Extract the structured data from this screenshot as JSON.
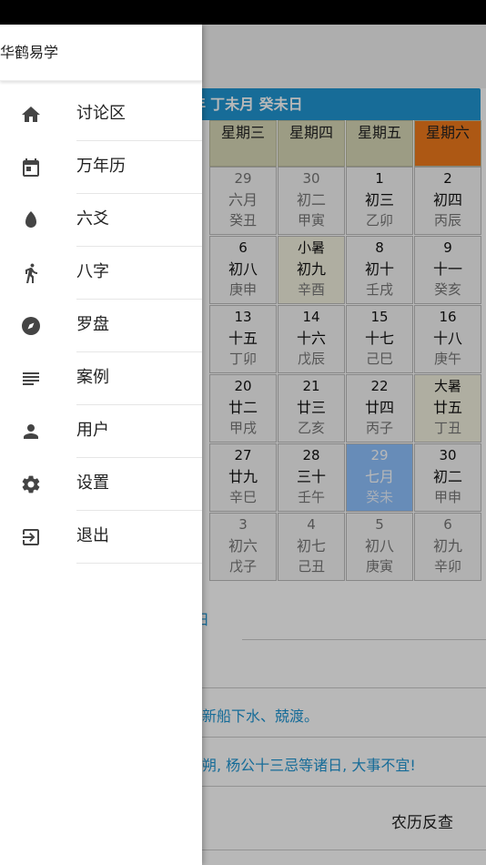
{
  "drawer": {
    "title": "华鹤易学",
    "items": [
      {
        "label": "讨论区",
        "icon": "home-icon"
      },
      {
        "label": "万年历",
        "icon": "calendar-icon"
      },
      {
        "label": "六爻",
        "icon": "leaf-icon"
      },
      {
        "label": "八字",
        "icon": "walk-icon"
      },
      {
        "label": "罗盘",
        "icon": "compass-icon"
      },
      {
        "label": "案例",
        "icon": "notes-icon"
      },
      {
        "label": "用户",
        "icon": "person-icon"
      },
      {
        "label": "设置",
        "icon": "settings-icon"
      },
      {
        "label": "退出",
        "icon": "exit-icon"
      }
    ]
  },
  "calendar": {
    "header_prefix": "年",
    "header": "丁未月 癸未日",
    "weekdays": [
      "星期三",
      "星期四",
      "星期五",
      "星期六"
    ],
    "weeks": [
      [
        {
          "d": "29",
          "l": "六月",
          "g": "癸丑",
          "t": "other"
        },
        {
          "d": "30",
          "l": "初二",
          "g": "甲寅",
          "t": "other"
        },
        {
          "d": "1",
          "l": "初三",
          "g": "乙卯",
          "t": ""
        },
        {
          "d": "2",
          "l": "初四",
          "g": "丙辰",
          "t": ""
        }
      ],
      [
        {
          "d": "6",
          "l": "初八",
          "g": "庚申",
          "t": ""
        },
        {
          "d": "小暑",
          "l": "初九",
          "g": "辛酉",
          "t": "term"
        },
        {
          "d": "8",
          "l": "初十",
          "g": "壬戌",
          "t": ""
        },
        {
          "d": "9",
          "l": "十一",
          "g": "癸亥",
          "t": ""
        }
      ],
      [
        {
          "d": "13",
          "l": "十五",
          "g": "丁卯",
          "t": ""
        },
        {
          "d": "14",
          "l": "十六",
          "g": "戊辰",
          "t": ""
        },
        {
          "d": "15",
          "l": "十七",
          "g": "己巳",
          "t": ""
        },
        {
          "d": "16",
          "l": "十八",
          "g": "庚午",
          "t": ""
        }
      ],
      [
        {
          "d": "20",
          "l": "廿二",
          "g": "甲戌",
          "t": ""
        },
        {
          "d": "21",
          "l": "廿三",
          "g": "乙亥",
          "t": ""
        },
        {
          "d": "22",
          "l": "廿四",
          "g": "丙子",
          "t": ""
        },
        {
          "d": "大暑",
          "l": "廿五",
          "g": "丁丑",
          "t": "term"
        }
      ],
      [
        {
          "d": "27",
          "l": "廿九",
          "g": "辛巳",
          "t": ""
        },
        {
          "d": "28",
          "l": "三十",
          "g": "壬午",
          "t": ""
        },
        {
          "d": "29",
          "l": "七月",
          "g": "癸未",
          "t": "today"
        },
        {
          "d": "30",
          "l": "初二",
          "g": "甲申",
          "t": ""
        }
      ],
      [
        {
          "d": "3",
          "l": "初六",
          "g": "戊子",
          "t": "other"
        },
        {
          "d": "4",
          "l": "初七",
          "g": "己丑",
          "t": "other"
        },
        {
          "d": "5",
          "l": "初八",
          "g": "庚寅",
          "t": "other"
        },
        {
          "d": "6",
          "l": "初九",
          "g": "辛卯",
          "t": "other"
        }
      ]
    ]
  },
  "below": {
    "fragment": "日",
    "avoid_text": "新船下水、兢渡。",
    "taboo_text": "朔, 杨公十三忌等诸日, 大事不宜!",
    "reverse_lookup": "农历反查"
  },
  "colors": {
    "header_blue": "#2196d3",
    "saturday_orange": "#f07a1c",
    "today_blue": "#8fc3ff"
  }
}
